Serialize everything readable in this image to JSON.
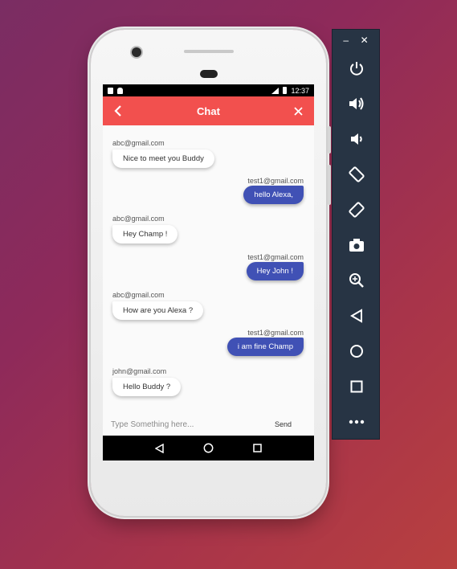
{
  "statusbar": {
    "time": "12:37"
  },
  "appbar": {
    "title": "Chat",
    "back_icon": "chevron-left-icon",
    "close_icon": "close-icon"
  },
  "messages": [
    {
      "sender": "abc@gmail.com",
      "text": "Nice to meet you Buddy",
      "side": "left"
    },
    {
      "sender": "test1@gmail.com",
      "text": "hello Alexa,",
      "side": "right"
    },
    {
      "sender": "abc@gmail.com",
      "text": "Hey Champ !",
      "side": "left"
    },
    {
      "sender": "test1@gmail.com",
      "text": "Hey John !",
      "side": "right"
    },
    {
      "sender": "abc@gmail.com",
      "text": "How are you Alexa ?",
      "side": "left"
    },
    {
      "sender": "test1@gmail.com",
      "text": "i am fine Champ",
      "side": "right"
    },
    {
      "sender": "john@gmail.com",
      "text": "Hello Buddy ?",
      "side": "left"
    }
  ],
  "composer": {
    "placeholder": "Type Something here...",
    "send_label": "Send"
  },
  "navbar": {
    "back_icon": "triangle-back-icon",
    "home_icon": "circle-home-icon",
    "recents_icon": "square-recents-icon"
  },
  "emulator_panel": {
    "minimize_label": "–",
    "close_label": "✕",
    "buttons": [
      "power-icon",
      "volume-up-icon",
      "volume-down-icon",
      "rotate-left-icon",
      "rotate-right-icon",
      "camera-icon",
      "zoom-icon",
      "back-icon",
      "home-icon",
      "overview-icon",
      "more-icon"
    ]
  },
  "colors": {
    "appbar": "#f2504e",
    "sent_bubble": "#4051b5",
    "panel": "#273444"
  }
}
